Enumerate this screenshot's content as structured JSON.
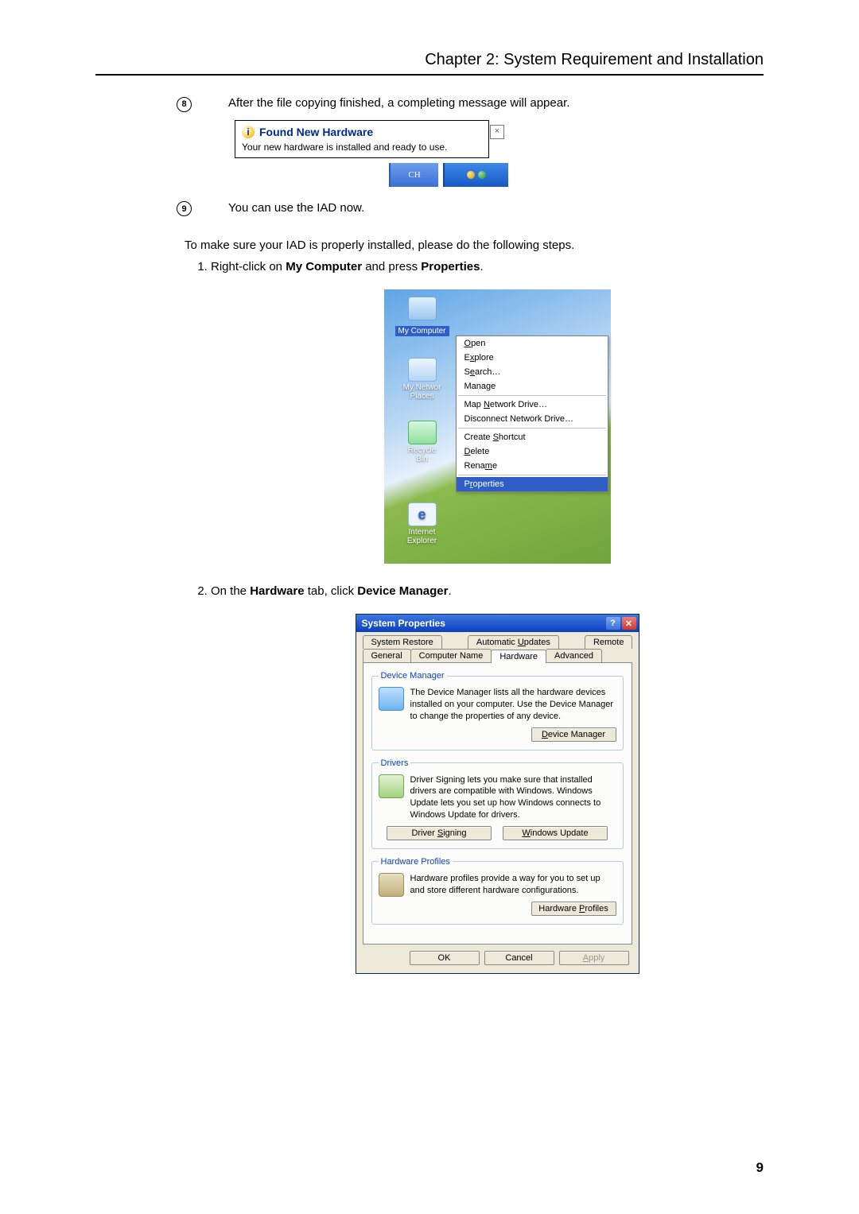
{
  "chapter": "Chapter 2: System Requirement and Installation",
  "bullets": {
    "eight": {
      "num": "8",
      "text": "After the file copying finished, a completing message will appear."
    },
    "nine": {
      "num": "9",
      "text": "You can use the IAD now."
    }
  },
  "balloon": {
    "title": "Found New Hardware",
    "msg": "Your new hardware is installed and ready to use.",
    "lang": "CH"
  },
  "verify_para": "To make sure your IAD is properly installed, please do the following steps.",
  "step1": {
    "pre": "Right-click on ",
    "b1": "My Computer",
    "mid": " and press ",
    "b2": "Properties",
    "post": "."
  },
  "desktop": {
    "mycomputer": "My Computer",
    "mynetwork": "My Networ Places",
    "recycle": "Recycle Bin",
    "ie1": "Internet",
    "ie2": "Explorer"
  },
  "ctx": {
    "open": "Open",
    "explore": "Explore",
    "search": "Search…",
    "manage": "Manage",
    "mapnet": "Map Network Drive…",
    "discnet": "Disconnect Network Drive…",
    "shortcut": "Create Shortcut",
    "delete": "Delete",
    "rename": "Rename",
    "properties": "Properties"
  },
  "step2": {
    "pre": "On the ",
    "b1": "Hardware",
    "mid": " tab, click ",
    "b2": "Device Manager",
    "post": "."
  },
  "dlg": {
    "title": "System Properties",
    "tabs": {
      "sysrestore": "System Restore",
      "autoupd": "Automatic Updates",
      "remote": "Remote",
      "general": "General",
      "compname": "Computer Name",
      "hardware": "Hardware",
      "advanced": "Advanced"
    },
    "dm": {
      "legend": "Device Manager",
      "text": "The Device Manager lists all the hardware devices installed on your computer. Use the Device Manager to change the properties of any device.",
      "btn": "Device Manager"
    },
    "drivers": {
      "legend": "Drivers",
      "text": "Driver Signing lets you make sure that installed drivers are compatible with Windows. Windows Update lets you set up how Windows connects to Windows Update for drivers.",
      "btn1": "Driver Signing",
      "btn2": "Windows Update"
    },
    "hp": {
      "legend": "Hardware Profiles",
      "text": "Hardware profiles provide a way for you to set up and store different hardware configurations.",
      "btn": "Hardware Profiles"
    },
    "ok": "OK",
    "cancel": "Cancel",
    "apply": "Apply"
  },
  "pagenum": "9"
}
